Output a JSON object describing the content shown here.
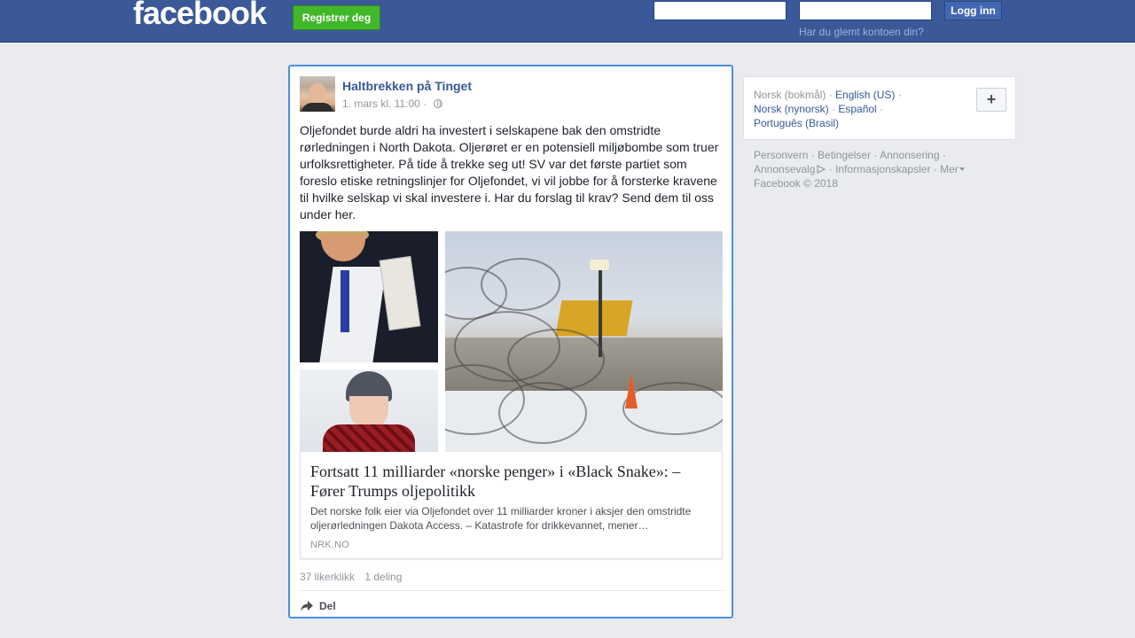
{
  "header": {
    "logo_text": "facebook",
    "register_label": "Registrer deg",
    "email_value": "",
    "password_value": "",
    "login_label": "Logg inn",
    "forgot_label": "Har du glemt kontoen din?"
  },
  "post": {
    "author": "Haltbrekken på Tinget",
    "date": "1. mars kl. 11:00",
    "meta_separator": "·",
    "text": "Oljefondet burde aldri ha investert i selskapene bak den omstridte rørledningen i North Dakota. Oljerøret er en potensiell miljøbombe som truer urfolksrettigheter. På tide å trekke seg ut! SV var det første partiet som foreslo etiske retningslinjer for Oljefondet, vi vil jobbe for å forsterke kravene til hvilke selskap vi skal investere i. Har du forslag til krav? Send dem til oss under her.",
    "link": {
      "title": "Fortsatt 11 milliarder «norske penger» i «Black Snake»: – Fører Trumps oljepolitikk",
      "description": "Det norske folk eier via Oljefondet over 11 milliarder kroner i aksjer den omstridte oljerørledningen Dakota Access. – Katastrofe for drikkevannet, mener…",
      "source": "NRK.NO"
    },
    "likes": "37 likerklikk",
    "shares": "1 deling",
    "share_label": "Del"
  },
  "sidebar": {
    "languages": {
      "current": "Norsk (bokmål)",
      "options": [
        "English (US)",
        "Norsk (nynorsk)",
        "Español",
        "Português (Brasil)"
      ]
    },
    "plus_label": "+",
    "footer": {
      "links": [
        "Personvern",
        "Betingelser",
        "Annonsering",
        "Annonsevalg",
        "Informasjonskapsler",
        "Mer"
      ],
      "copyright": "Facebook © 2018"
    }
  },
  "colors": {
    "brand": "#3b5998",
    "register_green": "#42b72a",
    "focus_border": "#4a90e2",
    "link_blue": "#365899"
  }
}
